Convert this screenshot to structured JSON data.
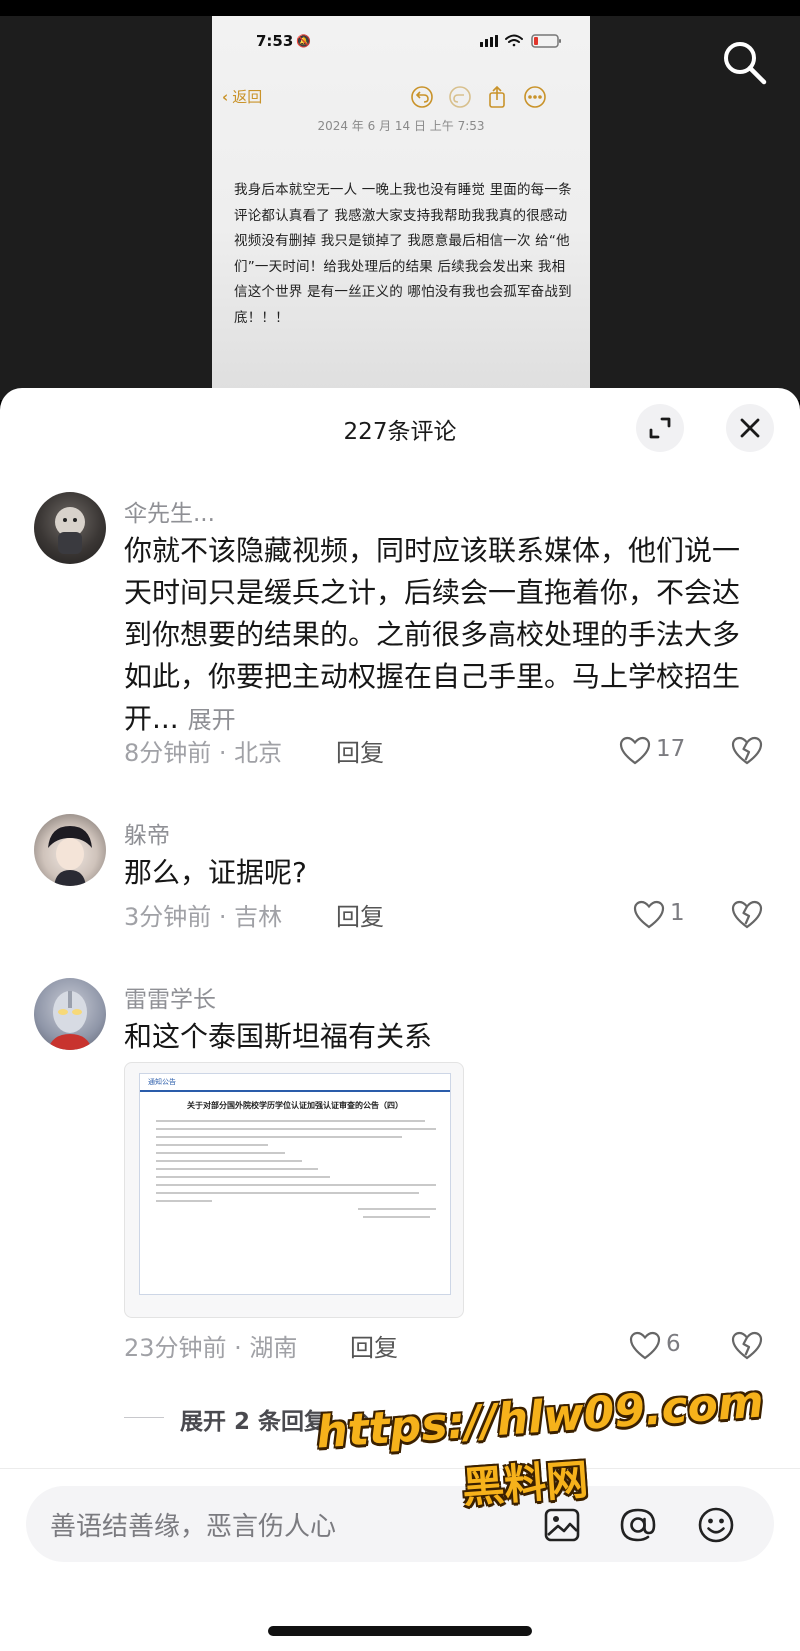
{
  "video": {
    "phone_status": {
      "time": "7:53"
    },
    "note": {
      "back_label": "返回",
      "date": "2024 年 6 月 14 日 上午 7:53",
      "body": "我身后本就空无一人 一晚上我也没有睡觉 里面的每一条评论都认真看了 我感激大家支持我帮助我我真的很感动 视频没有删掉 我只是锁掉了 我愿意最后相信一次 给“他们”一天时间！给我处理后的结果 后续我会发出来 我相信这个世界 是有一丝正义的 哪怕没有我也会孤军奋战到底！！！"
    }
  },
  "comments_panel": {
    "title": "227条评论",
    "comments": [
      {
        "username": "伞先生...",
        "text": "你就不该隐藏视频，同时应该联系媒体，他们说一天时间只是缓兵之计，后续会一直拖着你，不会达到你想要的结果的。之前很多高校处理的手法大多如此，你要把主动权握在自己手里。马上学校招生开...",
        "more_label": "展开",
        "meta": "8分钟前 · 北京",
        "reply_label": "回复",
        "likes": "17"
      },
      {
        "username": "躲帝",
        "text": "那么，证据呢?",
        "meta": "3分钟前 · 吉林",
        "reply_label": "回复",
        "likes": "1"
      },
      {
        "username": "雷雷学长",
        "text": "和这个泰国斯坦福有关系",
        "attachment": {
          "tag": "通知公告",
          "title": "关于对部分国外院校学历学位认证加强认证审查的公告（四）"
        },
        "meta": "23分钟前 · 湖南",
        "reply_label": "回复",
        "likes": "6",
        "expand_replies_label": "展开 2 条回复"
      }
    ],
    "input": {
      "placeholder": "善语结善缘，恶言伤人心"
    }
  },
  "watermark": {
    "url": "https://hlw09.com",
    "name": "黑料网"
  },
  "colors": {
    "note_accent": "#c9932a",
    "watermark": "#f6b21b",
    "sheet_bg": "#ffffff"
  }
}
